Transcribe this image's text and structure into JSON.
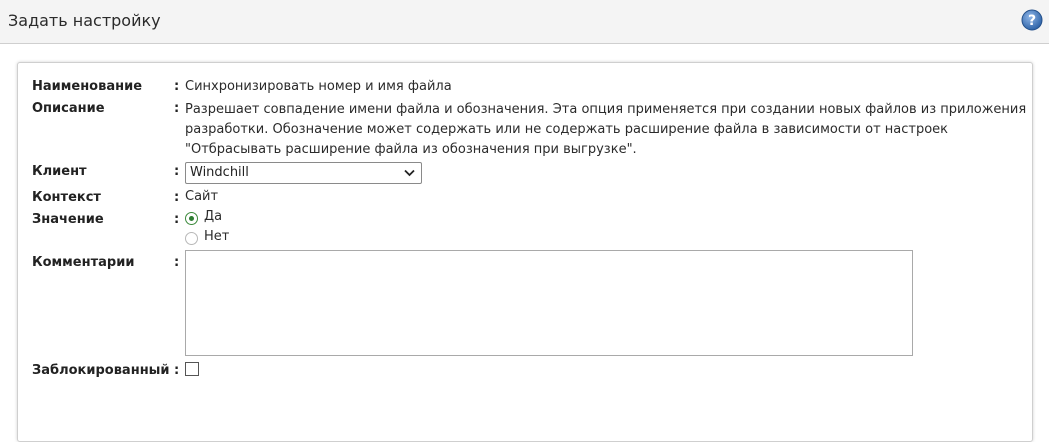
{
  "header": {
    "title": "Задать настройку",
    "help_icon": "help-icon"
  },
  "form": {
    "name": {
      "label": "Наименование",
      "value": "Синхронизировать номер и имя файла"
    },
    "description": {
      "label": "Описание",
      "value": "Разрешает совпадение имени файла и обозначения. Эта опция применяется при создании новых файлов из приложения разработки. Обозначение может содержать или не содержать расширение файла в зависимости от настроек \"Отбрасывать расширение файла из обозначения при выгрузке\"."
    },
    "client": {
      "label": "Клиент",
      "selected": "Windchill"
    },
    "context": {
      "label": "Контекст",
      "value": "Сайт"
    },
    "value": {
      "label": "Значение",
      "options": [
        {
          "label": "Да",
          "checked": true
        },
        {
          "label": "Нет",
          "checked": false
        }
      ]
    },
    "comments": {
      "label": "Комментарии",
      "text": ""
    },
    "locked": {
      "label": "Заблокированный",
      "checked": false
    },
    "colon": ":"
  },
  "colors": {
    "header_bg": "#f4f4f4",
    "help_icon": "#2f64a8",
    "radio_checked": "#2e7d32"
  }
}
